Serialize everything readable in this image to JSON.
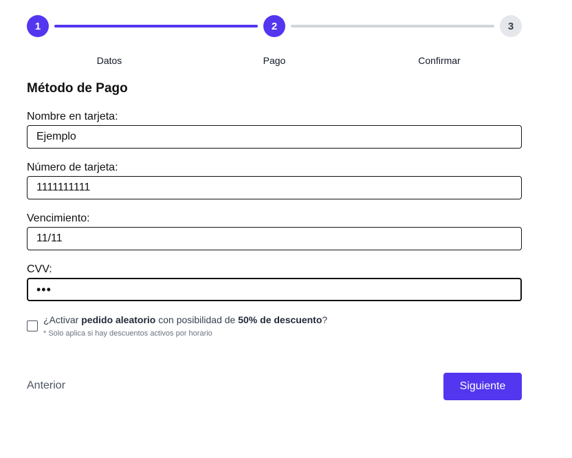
{
  "stepper": {
    "steps": [
      {
        "number": "1",
        "label": "Datos",
        "state": "complete"
      },
      {
        "number": "2",
        "label": "Pago",
        "state": "current"
      },
      {
        "number": "3",
        "label": "Confirmar",
        "state": "pending"
      }
    ],
    "colors": {
      "active": "#5236f0",
      "inactive": "#e5e7eb",
      "line_todo": "#d1d5db"
    }
  },
  "form": {
    "title": "Método de Pago",
    "fields": {
      "name": {
        "label": "Nombre en tarjeta:",
        "value": "Ejemplo"
      },
      "number": {
        "label": "Número de tarjeta:",
        "value": "1111111111"
      },
      "expiry": {
        "label": "Vencimiento:",
        "value": "11/11"
      },
      "cvv": {
        "label": "CVV:",
        "value": "•••"
      }
    },
    "random_order": {
      "checked": false,
      "text_prefix": "¿Activar ",
      "text_bold_1": "pedido aleatorio",
      "text_middle": " con posibilidad de ",
      "text_bold_2": "50% de descuento",
      "text_suffix": "?",
      "note": "* Solo aplica si hay descuentos activos por horario"
    }
  },
  "navigation": {
    "previous_label": "Anterior",
    "next_label": "Siguiente",
    "accent_color": "#5236f0"
  }
}
